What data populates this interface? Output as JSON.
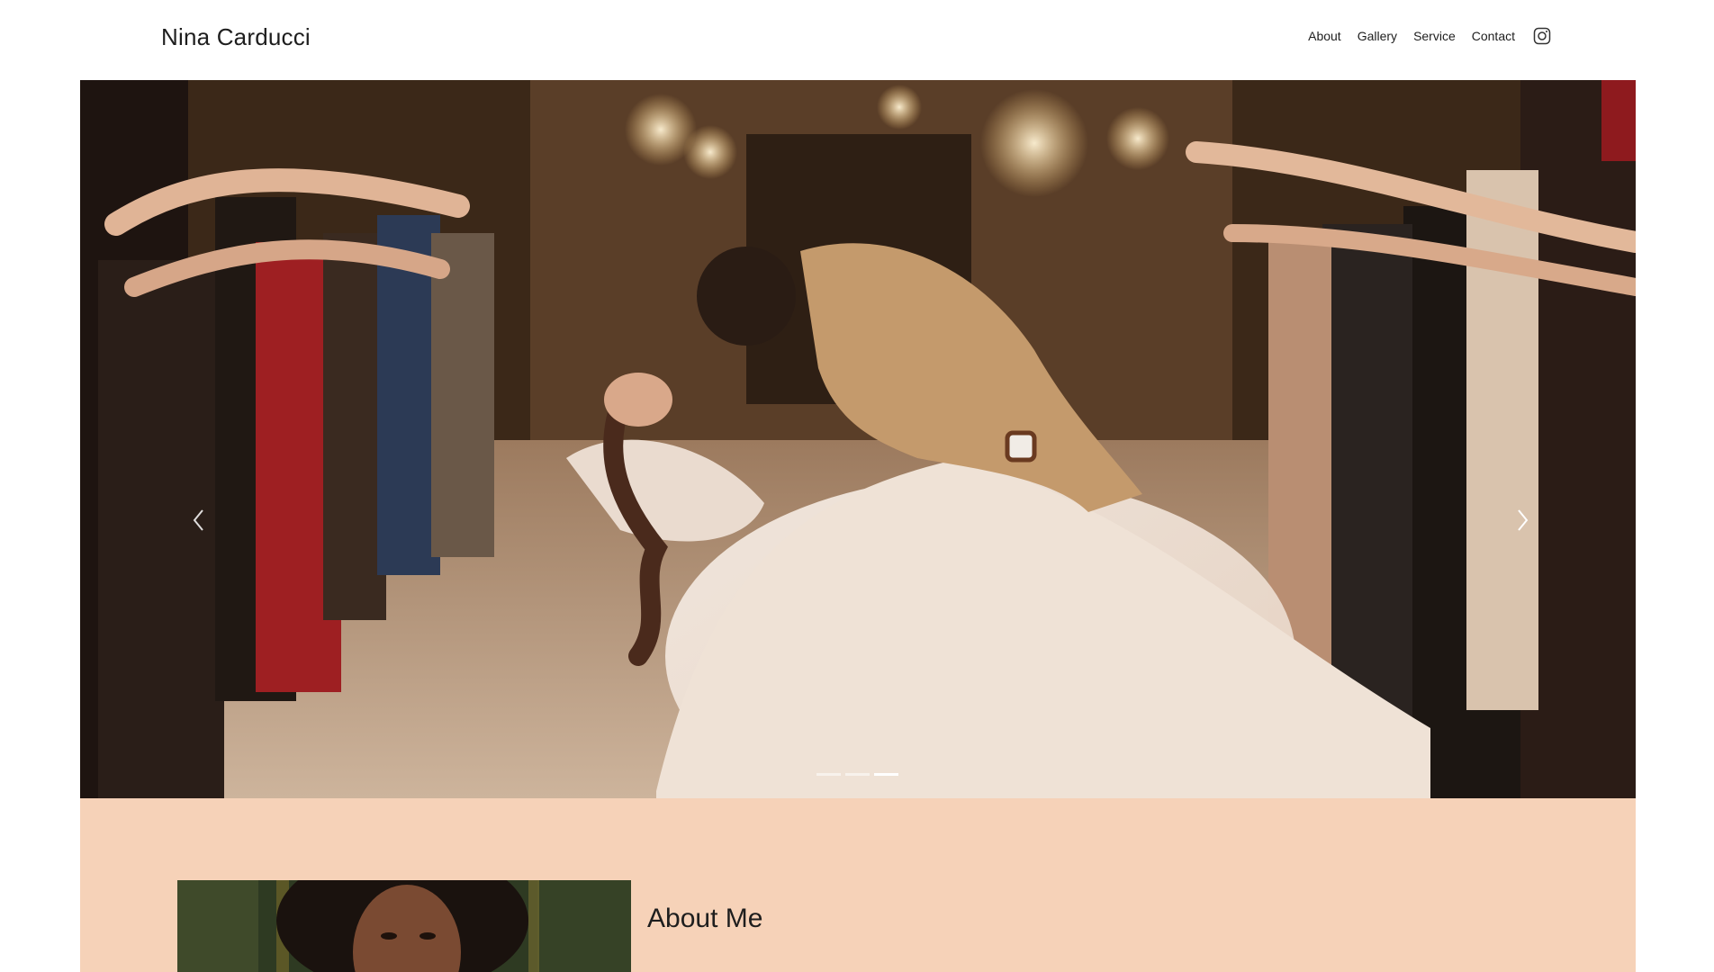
{
  "header": {
    "site_title": "Nina Carducci",
    "nav": [
      {
        "label": "About"
      },
      {
        "label": "Gallery"
      },
      {
        "label": "Service"
      },
      {
        "label": "Contact"
      }
    ],
    "social_icon": "instagram-icon"
  },
  "hero": {
    "slide_count": 3,
    "active_slide": 3,
    "prev_icon": "chevron-left-icon",
    "next_icon": "chevron-right-icon"
  },
  "about": {
    "title": "About Me"
  },
  "colors": {
    "about_background": "#f6d2b8",
    "text": "#1e1e1e"
  }
}
